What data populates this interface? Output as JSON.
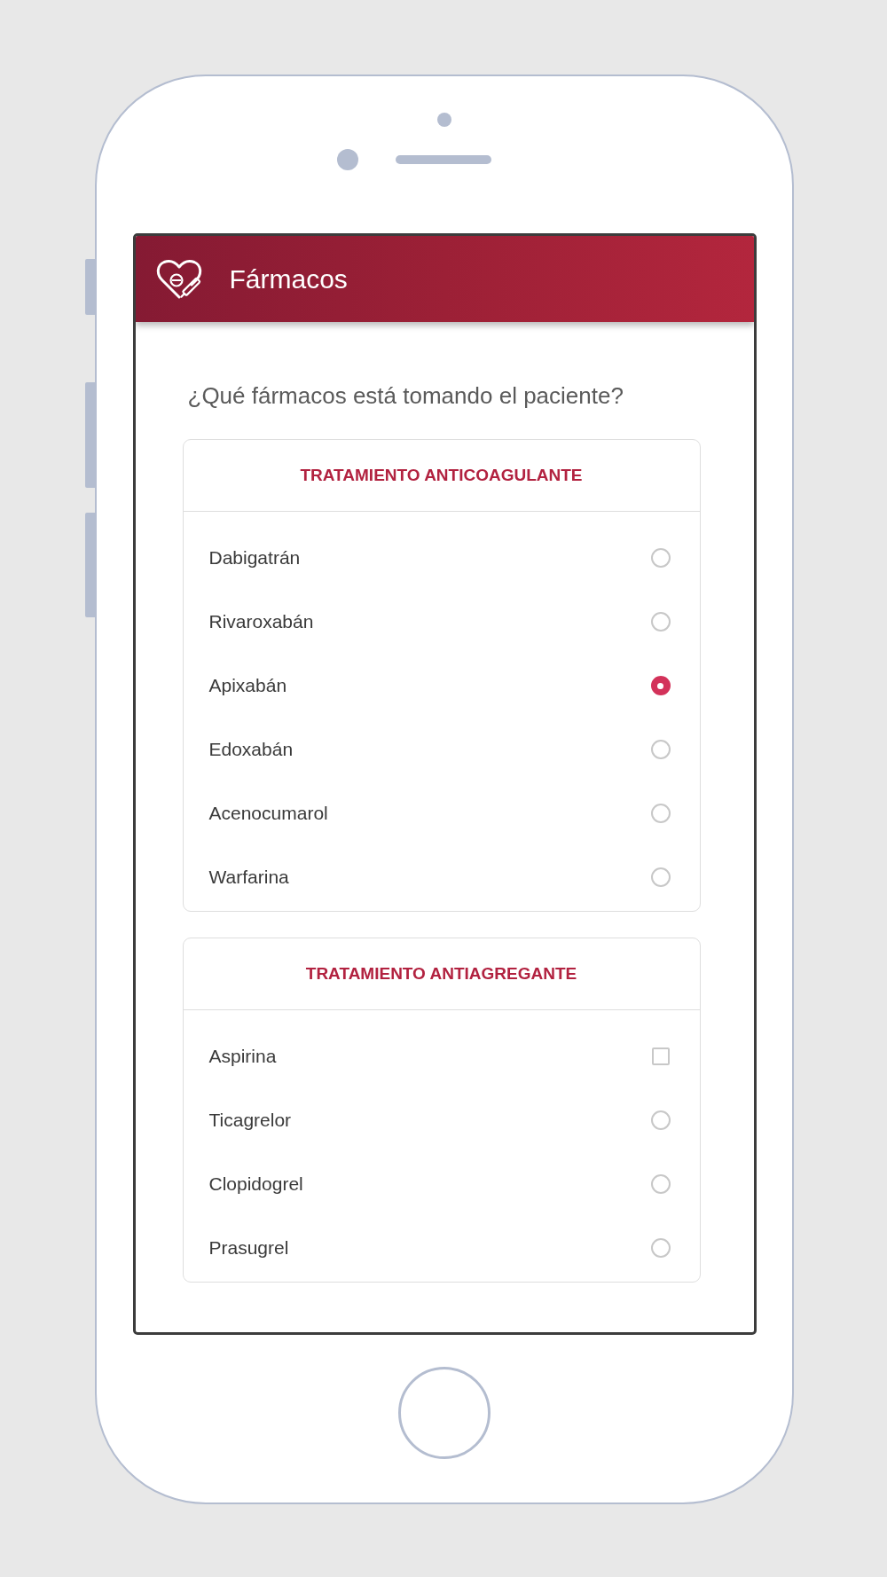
{
  "header": {
    "title": "Fármacos"
  },
  "question": "¿Qué fármacos está tomando el paciente?",
  "groups": [
    {
      "title": "TRATAMIENTO ANTICOAGULANTE",
      "options": [
        {
          "label": "Dabigatrán",
          "kind": "radio",
          "selected": false
        },
        {
          "label": "Rivaroxabán",
          "kind": "radio",
          "selected": false
        },
        {
          "label": "Apixabán",
          "kind": "radio",
          "selected": true
        },
        {
          "label": "Edoxabán",
          "kind": "radio",
          "selected": false
        },
        {
          "label": "Acenocumarol",
          "kind": "radio",
          "selected": false
        },
        {
          "label": "Warfarina",
          "kind": "radio",
          "selected": false
        }
      ]
    },
    {
      "title": "TRATAMIENTO ANTIAGREGANTE",
      "options": [
        {
          "label": "Aspirina",
          "kind": "checkbox",
          "selected": false
        },
        {
          "label": "Ticagrelor",
          "kind": "radio",
          "selected": false
        },
        {
          "label": "Clopidogrel",
          "kind": "radio",
          "selected": false
        },
        {
          "label": "Prasugrel",
          "kind": "radio",
          "selected": false
        }
      ]
    }
  ]
}
